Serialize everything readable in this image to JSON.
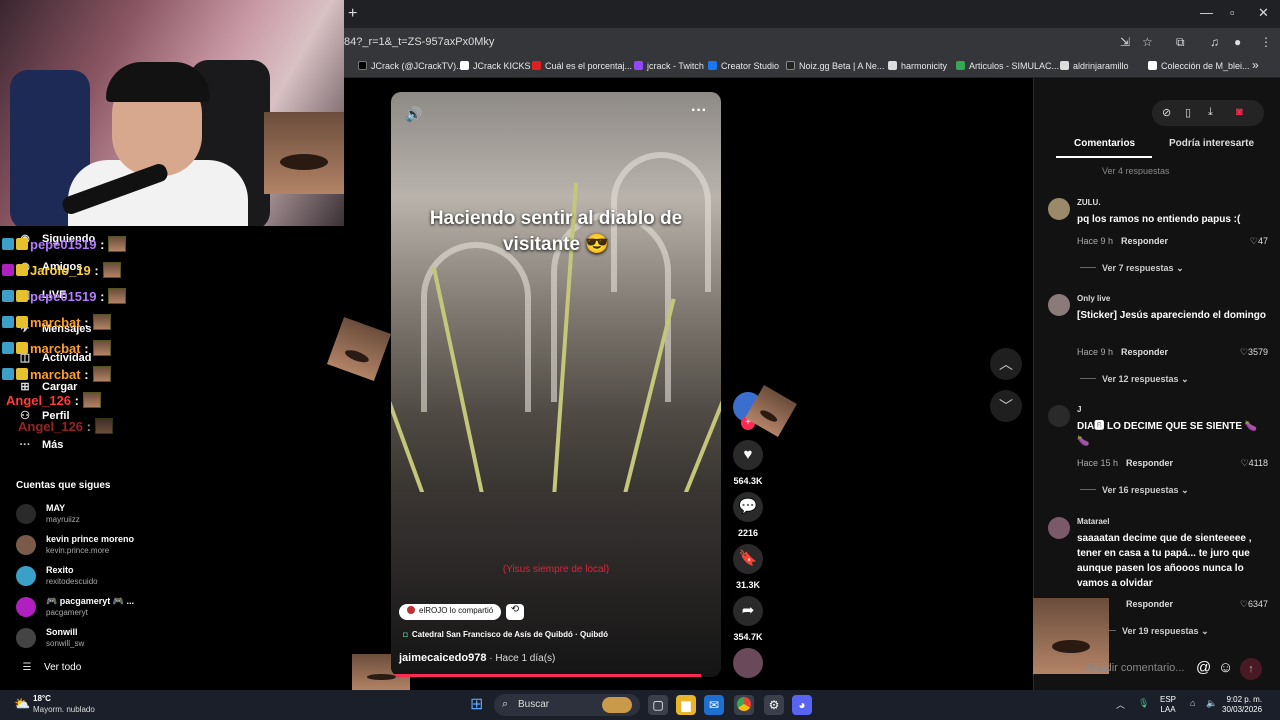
{
  "browser": {
    "new_tab": "+",
    "url": "84?_r=1&_t=ZS-957axPx0Mky",
    "bookmarks": [
      {
        "label": "JCrack (@JCrackTV)...",
        "color": "#000000"
      },
      {
        "label": "JCrack KICKS",
        "color": "#ffffff"
      },
      {
        "label": "Cuál es el porcentaj...",
        "color": "#e02020"
      },
      {
        "label": "jcrack - Twitch",
        "color": "#9146ff"
      },
      {
        "label": "Creator Studio",
        "color": "#1877f2"
      },
      {
        "label": "Noiz.gg Beta | A Ne...",
        "color": "#222222"
      },
      {
        "label": "harmonicity",
        "color": "#dddddd"
      },
      {
        "label": "Articulos - SIMULAC...",
        "color": "#34a853"
      },
      {
        "label": "aldrinjaramillo",
        "color": "#dddddd"
      },
      {
        "label": "Colección de M_blei...",
        "color": "#ffffff"
      }
    ],
    "bookmarks_more": "»"
  },
  "sidebar": {
    "nav": [
      {
        "label": "Siguiendo",
        "icon": "people-icon"
      },
      {
        "label": "Amigos",
        "icon": "friends-icon"
      },
      {
        "label": "LIVE",
        "icon": "live-icon"
      },
      {
        "label": "Mensajes",
        "icon": "message-icon"
      },
      {
        "label": "Actividad",
        "icon": "bell-icon"
      },
      {
        "label": "Cargar",
        "icon": "plus-icon"
      },
      {
        "label": "Perfil",
        "icon": "profile-icon"
      },
      {
        "label": "Más",
        "icon": "more-icon"
      }
    ],
    "following_title": "Cuentas que sigues",
    "following": [
      {
        "name": "MAY",
        "handle": "mayruiizz",
        "color": "#2a2a2a"
      },
      {
        "name": "kevin prince moreno",
        "handle": "kevin.prince.more",
        "color": "#7a5a48"
      },
      {
        "name": "Rexito",
        "handle": "rexitodescuido",
        "color": "#3aa0c8"
      },
      {
        "name": "🎮 pacgameryt 🎮 ...",
        "handle": "pacgameryt",
        "color": "#b020c0"
      },
      {
        "name": "Sonwill",
        "handle": "sonwill_sw",
        "color": "#444444"
      }
    ],
    "see_all": "Ver todo"
  },
  "chat": [
    {
      "user": "pepe01519",
      "sep": " :",
      "color": "#b57cff"
    },
    {
      "user": "Jarolo_19",
      "sep": " :",
      "color": "#ffd23a"
    },
    {
      "user": "pepe01519",
      "sep": " :",
      "color": "#b57cff"
    },
    {
      "user": "marcbat",
      "sep": " :",
      "color": "#ff9e2c"
    },
    {
      "user": "marcbat",
      "sep": " :",
      "color": "#ff9e2c"
    },
    {
      "user": "marcbat",
      "sep": " :",
      "color": "#ff9e2c"
    },
    {
      "user": "Angel_126",
      "sep": " :",
      "color": "#ff3b3b"
    },
    {
      "user": "Angel_126",
      "sep": " :",
      "color": "#ff3b3b"
    }
  ],
  "video": {
    "caption": "Haciendo sentir al diablo de visitante 😎",
    "subtitle": "(Yisus siempre de local)",
    "shared_by": "elROJO lo compartió",
    "location": "Catedral San Francisco de Asís de Quibdó · Quibdó",
    "author": "jaimecaicedo978",
    "posted": " · Hace 1 día(s)",
    "progress": 0.94
  },
  "actions": {
    "likes": "564.3K",
    "comments": "2216",
    "saves": "31.3K",
    "shares": "354.7K"
  },
  "panel": {
    "tabs": [
      "Comentarios",
      "Podría interesarte"
    ],
    "comments": [
      {
        "user": "ZULU.",
        "text": "pq los ramos no entiendo papus :(",
        "time": "Hace 9 h",
        "reply": "Responder",
        "likes": "47",
        "replies": "Ver 7 respuestas",
        "color": "#9a8a6a"
      },
      {
        "user": "Only live",
        "text": "[Sticker] Jesús apareciendo el domingo",
        "time": "Hace 9 h",
        "reply": "Responder",
        "likes": "3579",
        "replies": "Ver 12 respuestas",
        "color": "#8a7a7a"
      },
      {
        "user": "J",
        "text": "DIA🅱 LO DECIME QUE SE SIENTE 🍆🍆",
        "time": "Hace 15 h",
        "reply": "Responder",
        "likes": "4118",
        "replies": "Ver 16 respuestas",
        "color": "#2a2a2a"
      },
      {
        "user": "Matarael",
        "text": "saaaatan decime que de sienteeeee , tener en casa a tu papá... te juro que aunque pasen los añooos nunca lo vamos a olvidar",
        "time": "",
        "reply": "Responder",
        "likes": "6347",
        "replies": "Ver 19 respuestas",
        "color": "#7a5a68"
      }
    ],
    "add_comment": "Añadir comentario...",
    "top_partial": "Ver 4 respuestas"
  },
  "taskbar": {
    "temp": "18°C",
    "weather": "Mayorm. nublado",
    "search": "Buscar",
    "lang1": "ESP",
    "lang2": "LAA",
    "time": "9:02 p. m.",
    "date": "30/03/2026"
  }
}
